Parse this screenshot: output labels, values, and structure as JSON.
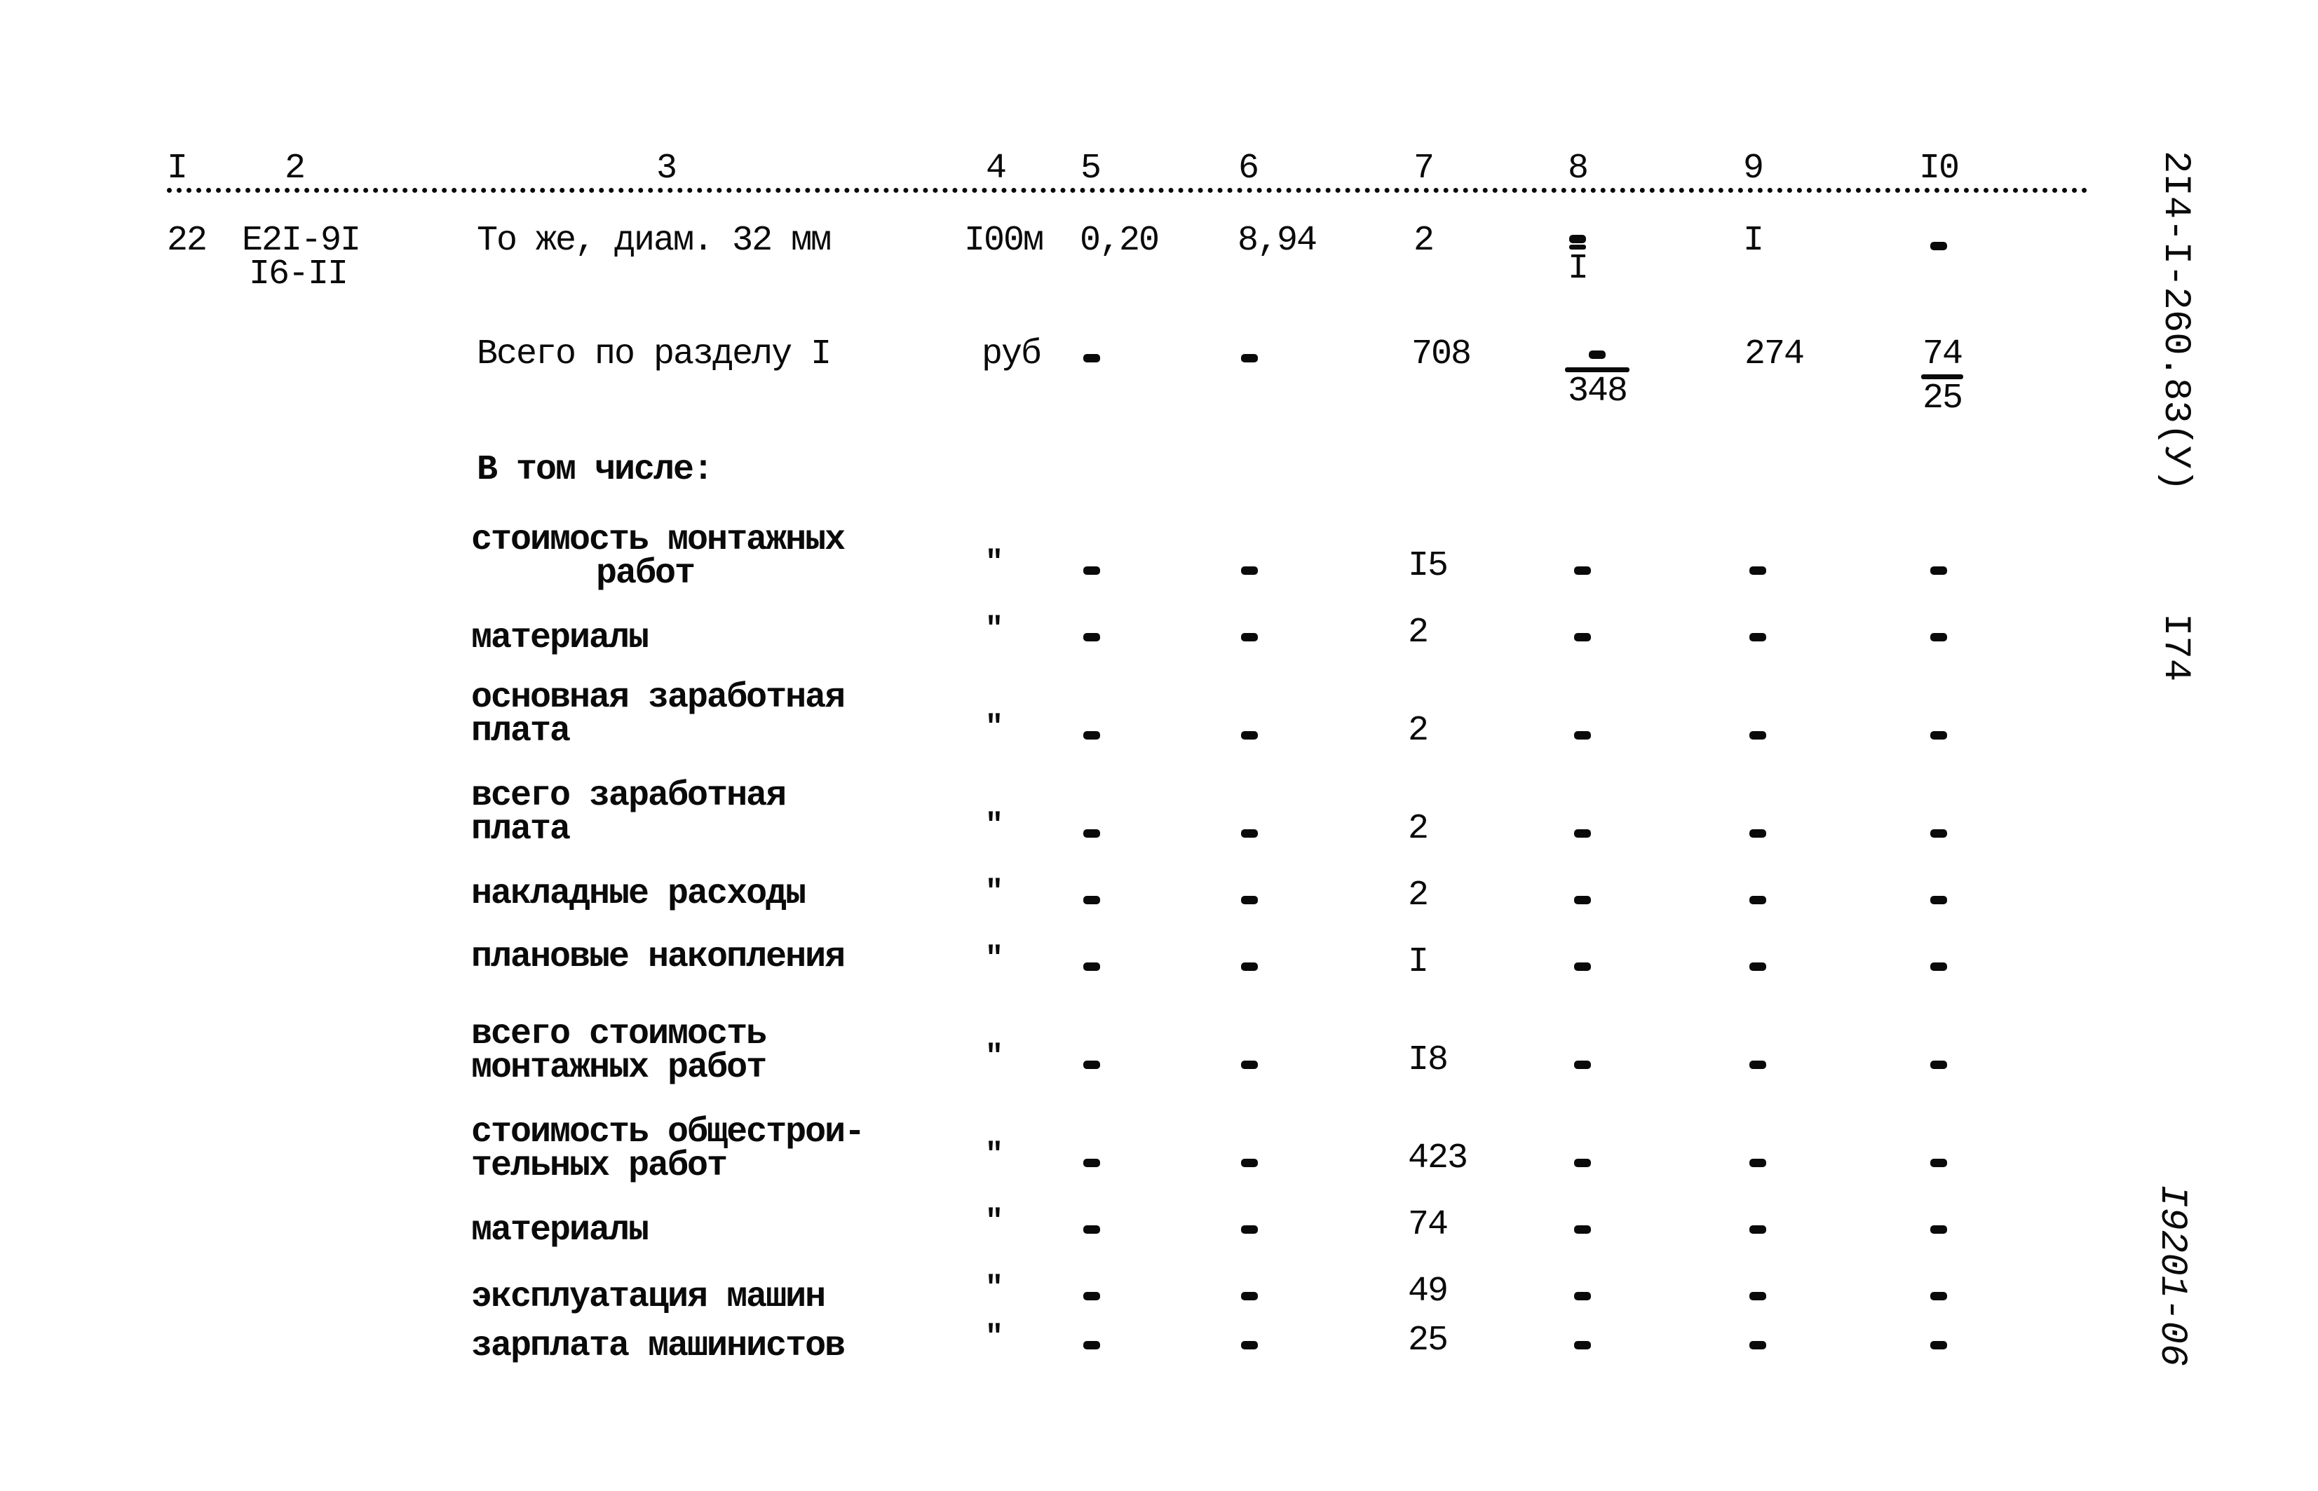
{
  "header": {
    "columns": [
      "I",
      "2",
      "3",
      "4",
      "5",
      "6",
      "7",
      "8",
      "9",
      "I0"
    ]
  },
  "margin": {
    "code": "2I4-I-260.83(У)",
    "page_number": "I74",
    "doc_number": "I9201-06"
  },
  "item": {
    "num": "22",
    "code_line1": "Е2I-9I",
    "code_line2": "I6-II",
    "name": "То же, диам. 32 мм",
    "unit": "I00м",
    "col5": "0,20",
    "col6": "8,94",
    "col7": "2",
    "col8_top": "-",
    "col8_bottom": "I",
    "col9": "I",
    "col10": "-"
  },
  "total": {
    "name": "Всего по разделу I",
    "unit": "руб",
    "col5": "-",
    "col6": "-",
    "col7": "708",
    "col8_top": "-",
    "col8_bottom": "348",
    "col9": "274",
    "col10_top": "74",
    "col10_bottom": "25"
  },
  "including_label": "В том числе:",
  "breakdown": [
    {
      "line1": "стоимость монтажных",
      "line2": "работ",
      "indent2": true,
      "unit": "\"",
      "col5": "-",
      "col6": "-",
      "col7": "I5",
      "col8": "-",
      "col9": "-",
      "col10": "-"
    },
    {
      "line1": "материалы",
      "line2": "",
      "unit": "\"",
      "col5": "-",
      "col6": "-",
      "col7": "2",
      "col8": "-",
      "col9": "-",
      "col10": "-"
    },
    {
      "line1": "основная заработная",
      "line2": "плата",
      "unit": "\"",
      "col5": "-",
      "col6": "-",
      "col7": "2",
      "col8": "-",
      "col9": "-",
      "col10": "-"
    },
    {
      "line1": "всего заработная",
      "line2": "плата",
      "unit": "\"",
      "col5": "-",
      "col6": "-",
      "col7": "2",
      "col8": "-",
      "col9": "-",
      "col10": "-"
    },
    {
      "line1": "накладные расходы",
      "line2": "",
      "unit": "\"",
      "col5": "-",
      "col6": "-",
      "col7": "2",
      "col8": "-",
      "col9": "-",
      "col10": "-"
    },
    {
      "line1": "плановые накопления",
      "line2": "",
      "unit": "\"",
      "col5": "-",
      "col6": "-",
      "col7": "I",
      "col8": "-",
      "col9": "-",
      "col10": "-"
    },
    {
      "line1": "всего стоимость",
      "line2": "монтажных работ",
      "unit": "\"",
      "col5": "-",
      "col6": "-",
      "col7": "I8",
      "col8": "-",
      "col9": "-",
      "col10": "-"
    },
    {
      "line1": "стоимость общестрои-",
      "line2": "тельных работ",
      "unit": "\"",
      "col5": "-",
      "col6": "-",
      "col7": "423",
      "col8": "-",
      "col9": "-",
      "col10": "-"
    },
    {
      "line1": "материалы",
      "line2": "",
      "unit": "\"",
      "col5": "-",
      "col6": "-",
      "col7": "74",
      "col8": "-",
      "col9": "-",
      "col10": "-"
    },
    {
      "line1": "эксплуатация машин",
      "line2": "",
      "unit": "\"",
      "col5": "-",
      "col6": "-",
      "col7": "49",
      "col8": "-",
      "col9": "-",
      "col10": "-"
    },
    {
      "line1": "зарплата машинистов",
      "line2": "",
      "unit": "\"",
      "col5": "-",
      "col6": "-",
      "col7": "25",
      "col8": "-",
      "col9": "-",
      "col10": "-"
    }
  ]
}
